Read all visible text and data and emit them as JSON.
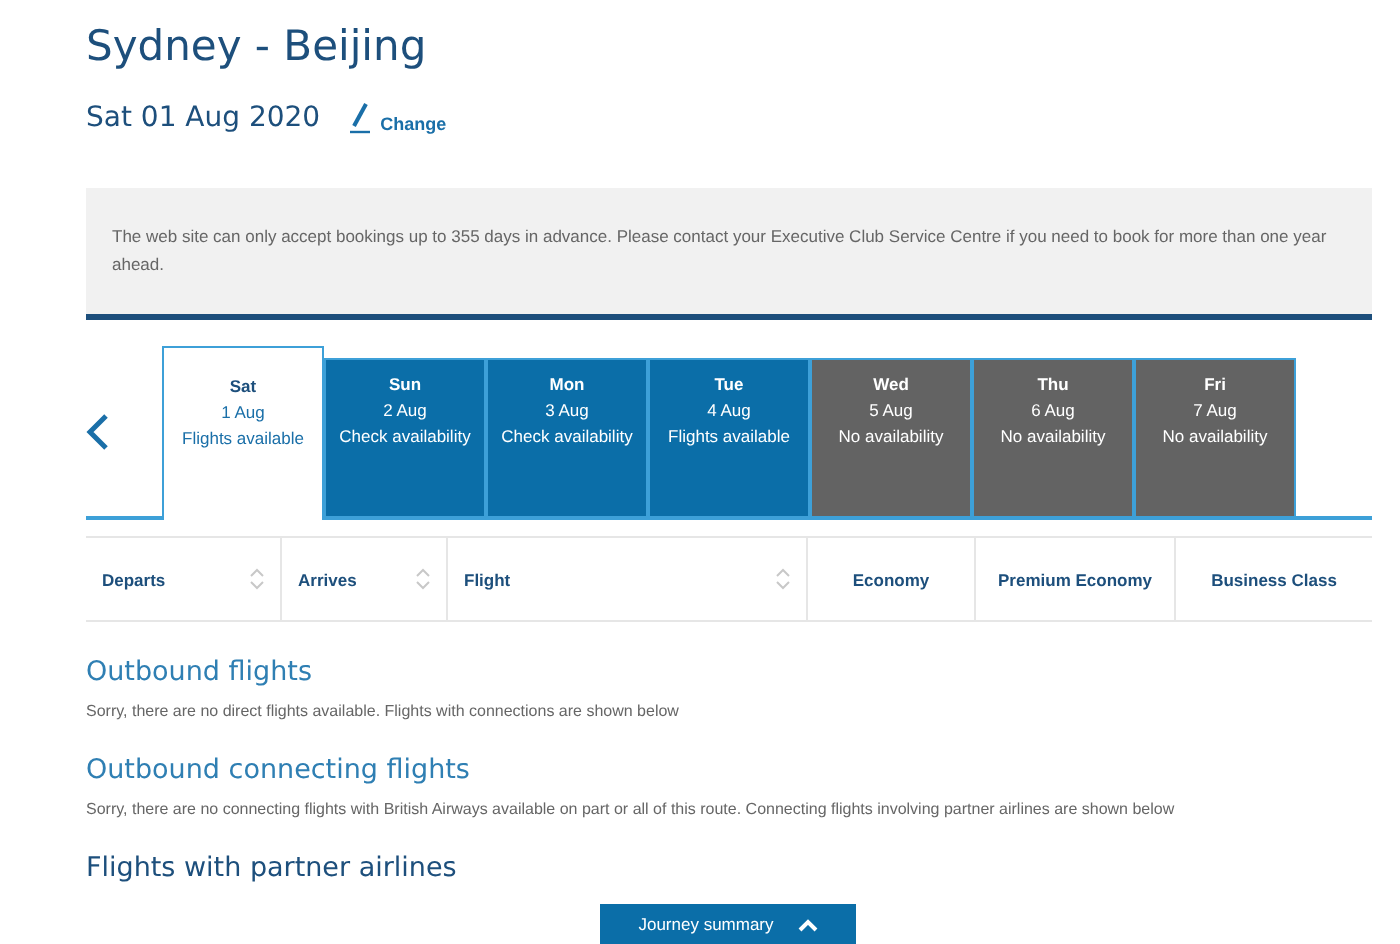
{
  "title": "Sydney - Beijing",
  "date": {
    "text": "Sat 01 Aug 2020",
    "change_link": "Change"
  },
  "notice": "The web site can only accept bookings up to 355 days in advance. Please contact your Executive Club Service Centre if you need to book for more than one year ahead.",
  "date_tabs": [
    {
      "day": "Sat",
      "date": "1 Aug",
      "status": "Flights available",
      "kind": "open",
      "selected": true
    },
    {
      "day": "Sun",
      "date": "2 Aug",
      "status": "Check availability",
      "kind": "open",
      "selected": false
    },
    {
      "day": "Mon",
      "date": "3 Aug",
      "status": "Check availability",
      "kind": "open",
      "selected": false
    },
    {
      "day": "Tue",
      "date": "4 Aug",
      "status": "Flights available",
      "kind": "open",
      "selected": false
    },
    {
      "day": "Wed",
      "date": "5 Aug",
      "status": "No availability",
      "kind": "closed",
      "selected": false
    },
    {
      "day": "Thu",
      "date": "6 Aug",
      "status": "No availability",
      "kind": "closed",
      "selected": false
    },
    {
      "day": "Fri",
      "date": "7 Aug",
      "status": "No availability",
      "kind": "closed",
      "selected": false
    }
  ],
  "columns": [
    {
      "label": "Departs",
      "sortable": true
    },
    {
      "label": "Arrives",
      "sortable": true
    },
    {
      "label": "Flight",
      "sortable": true
    },
    {
      "label": "Economy",
      "sortable": false
    },
    {
      "label": "Premium Economy",
      "sortable": false
    },
    {
      "label": "Business Class",
      "sortable": false
    }
  ],
  "sections": [
    {
      "heading": "Outbound flights",
      "message": "Sorry, there are no direct flights available. Flights with connections are shown below"
    },
    {
      "heading": "Outbound connecting flights",
      "message": "Sorry, there are no connecting flights with British Airways available on part or all of this route. Connecting flights involving partner airlines are shown below"
    },
    {
      "heading": "Flights with partner airlines"
    }
  ],
  "journey_summary": {
    "label": "Journey summary",
    "expanded": false
  }
}
